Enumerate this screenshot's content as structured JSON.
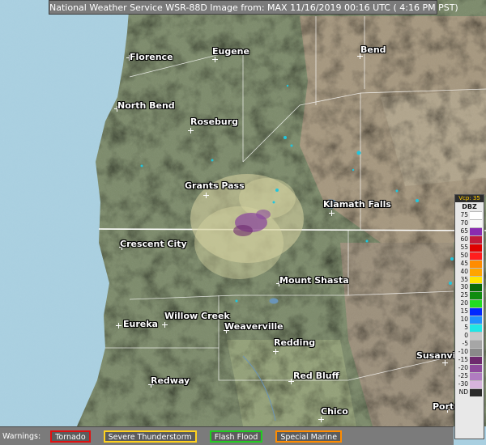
{
  "header": {
    "title": "National Weather Service WSR-88D Image from: MAX 11/16/2019 00:16 UTC ( 4:16 PM PST)"
  },
  "map": {
    "cities": [
      {
        "name": "Florence"
      },
      {
        "name": "Eugene"
      },
      {
        "name": "Bend"
      },
      {
        "name": "North Bend"
      },
      {
        "name": "Roseburg"
      },
      {
        "name": "Grants Pass"
      },
      {
        "name": "Klamath Falls"
      },
      {
        "name": "Crescent City"
      },
      {
        "name": "Mount Shasta"
      },
      {
        "name": "Willow Creek"
      },
      {
        "name": "Eureka"
      },
      {
        "name": "Weaverville"
      },
      {
        "name": "Redding"
      },
      {
        "name": "Susanville"
      },
      {
        "name": "Redway"
      },
      {
        "name": "Red Bluff"
      },
      {
        "name": "Chico"
      },
      {
        "name": "Portola"
      }
    ],
    "colors": {
      "ocean": "#a9cfe0",
      "terrain": "#7c8a6e",
      "highland": "#a89a86",
      "valley": "#8e9c77",
      "border": "#ffffff",
      "echo_light": "#d8d4a2",
      "echo_heavy": "#8b4a9c",
      "echo_cyan": "#21c6dd"
    }
  },
  "legend": {
    "vcp_label": "Vcp: 35",
    "unit": "DBZ",
    "rows": [
      {
        "value": "75",
        "color": "#ffffff"
      },
      {
        "value": "70",
        "color": "#f7f7f7"
      },
      {
        "value": "65",
        "color": "#8a2bb0"
      },
      {
        "value": "60",
        "color": "#c21a3a"
      },
      {
        "value": "55",
        "color": "#e00000"
      },
      {
        "value": "50",
        "color": "#ff1e1e"
      },
      {
        "value": "45",
        "color": "#ff8c00"
      },
      {
        "value": "40",
        "color": "#ffa500"
      },
      {
        "value": "35",
        "color": "#ffe600"
      },
      {
        "value": "30",
        "color": "#0a6b0a"
      },
      {
        "value": "25",
        "color": "#108c10"
      },
      {
        "value": "20",
        "color": "#22dd22"
      },
      {
        "value": "15",
        "color": "#0028ff"
      },
      {
        "value": "10",
        "color": "#2090ff"
      },
      {
        "value": "5",
        "color": "#20e6e6"
      },
      {
        "value": "0",
        "color": "#c8c8c8"
      },
      {
        "value": "-5",
        "color": "#a6a6a6"
      },
      {
        "value": "-10",
        "color": "#8a8a8a"
      },
      {
        "value": "-15",
        "color": "#6e2a6e"
      },
      {
        "value": "-20",
        "color": "#8e4a9c"
      },
      {
        "value": "-25",
        "color": "#b07cc0"
      },
      {
        "value": "-30",
        "color": "#d6b4dc"
      },
      {
        "value": "ND",
        "color": "#2a2a2a"
      }
    ]
  },
  "warnings": {
    "label": "Warnings:",
    "items": [
      {
        "name": "Tornado",
        "color": "#e01010"
      },
      {
        "name": "Severe Thunderstorm",
        "color": "#ffd21e"
      },
      {
        "name": "Flash Flood",
        "color": "#22cc22"
      },
      {
        "name": "Special Marine",
        "color": "#ff8c00"
      }
    ]
  }
}
